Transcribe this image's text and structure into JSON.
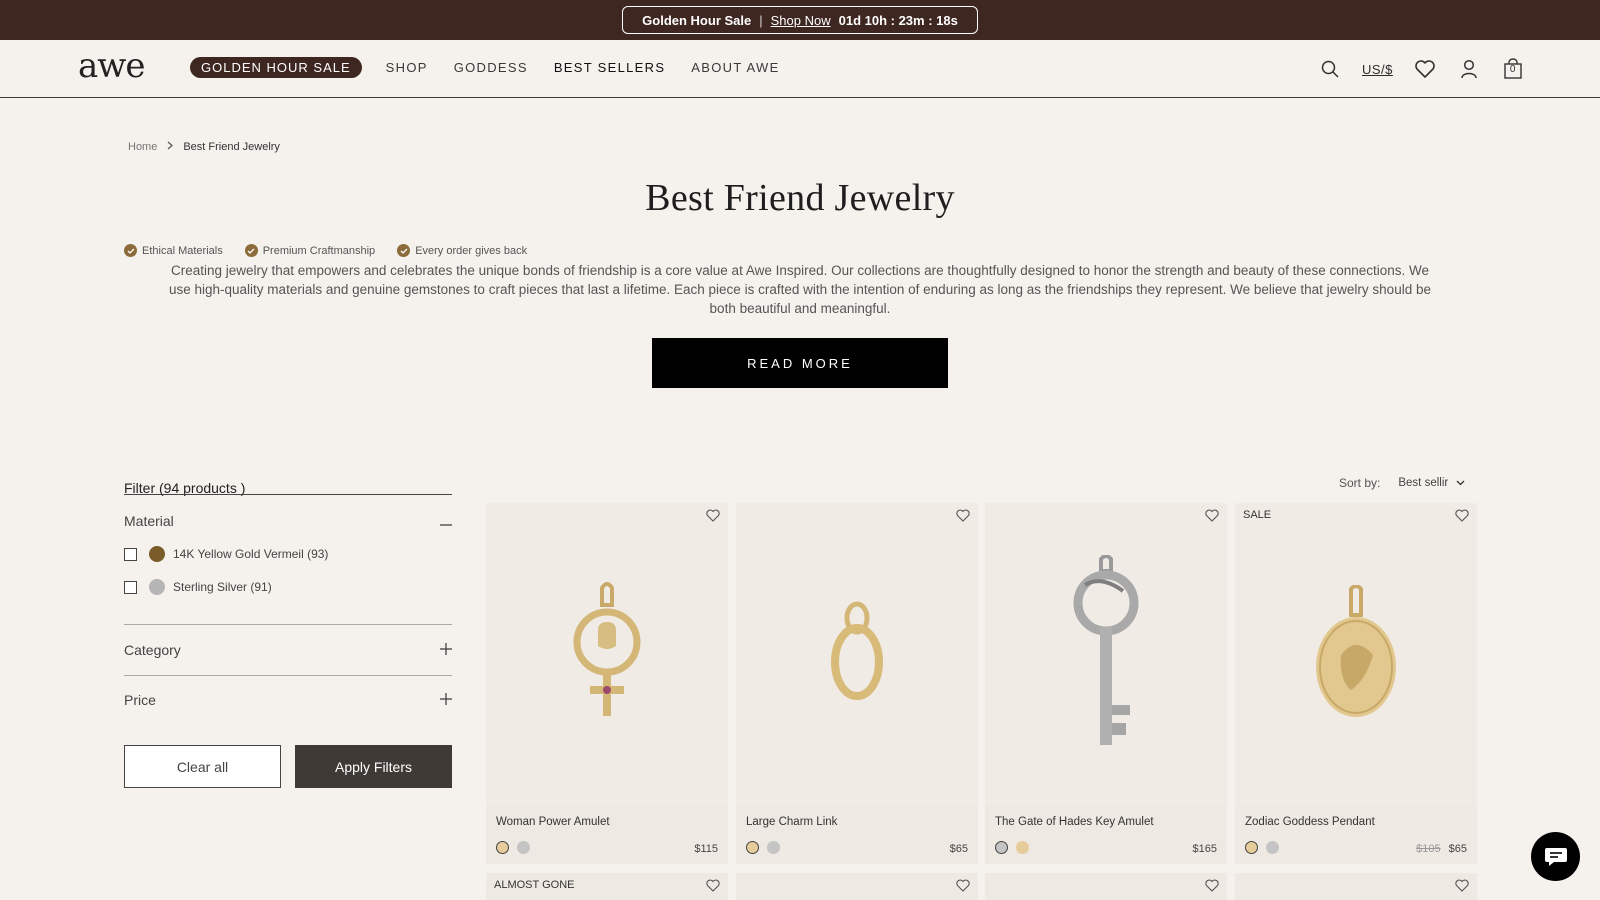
{
  "announcement": {
    "title": "Golden Hour Sale",
    "separator": "|",
    "link": "Shop Now",
    "countdown": "01d 10h : 23m : 18s"
  },
  "header": {
    "logo": "awe",
    "nav": {
      "sale_pill": "GOLDEN HOUR SALE",
      "items": [
        "SHOP",
        "GODDESS",
        "BEST SELLERS",
        "ABOUT AWE"
      ]
    },
    "currency": "US/$",
    "cart_count": "0",
    "icons": [
      "search-icon",
      "heart-icon",
      "account-icon",
      "bag-icon"
    ]
  },
  "breadcrumb": {
    "home": "Home",
    "current": "Best Friend Jewelry"
  },
  "page": {
    "title": "Best Friend Jewelry",
    "badges": [
      "Ethical Materials",
      "Premium Craftmanship",
      "Every order gives back"
    ],
    "intro": "Creating jewelry that empowers and celebrates the unique bonds of friendship is a core value at Awe Inspired. Our collections are thoughtfully designed to honor the strength and beauty of these connections. We use high-quality materials and genuine gemstones to craft pieces that last a lifetime. Each piece is crafted with the intention of enduring as long as the friendships they represent. We believe that jewelry should be both beautiful and meaningful.",
    "read_more": "READ MORE"
  },
  "filters": {
    "title": "Filter (94 products )",
    "material": {
      "label": "Material",
      "options": [
        {
          "label": "14K Yellow Gold Vermeil (93)",
          "color": "#7a5c2a"
        },
        {
          "label": "Sterling Silver (91)",
          "color": "#b5b5b5"
        }
      ]
    },
    "category": "Category",
    "price": "Price",
    "clear": "Clear all",
    "apply": "Apply Filters"
  },
  "sort": {
    "label": "Sort by:",
    "value": "Best sellir"
  },
  "products": [
    {
      "name": "Woman Power Amulet",
      "price": "$115",
      "old_price": "",
      "tag": "",
      "swatches": [
        "gold",
        "silver"
      ]
    },
    {
      "name": "Large Charm Link",
      "price": "$65",
      "old_price": "",
      "tag": "",
      "swatches": [
        "gold",
        "silver"
      ]
    },
    {
      "name": "The Gate of Hades Key Amulet",
      "price": "$165",
      "old_price": "",
      "tag": "",
      "swatches": [
        "silver-selected",
        "gold"
      ]
    },
    {
      "name": "Zodiac Goddess Pendant",
      "price": "$65",
      "old_price": "$105",
      "tag": "SALE",
      "swatches": [
        "gold",
        "silver"
      ]
    }
  ],
  "products_row2": [
    {
      "tag": "ALMOST GONE"
    },
    {
      "tag": ""
    },
    {
      "tag": ""
    },
    {
      "tag": ""
    }
  ],
  "colors": {
    "brand_dark": "#3e2621",
    "accent_gold": "#8b6b3a",
    "button_dark": "#3f3a36"
  }
}
